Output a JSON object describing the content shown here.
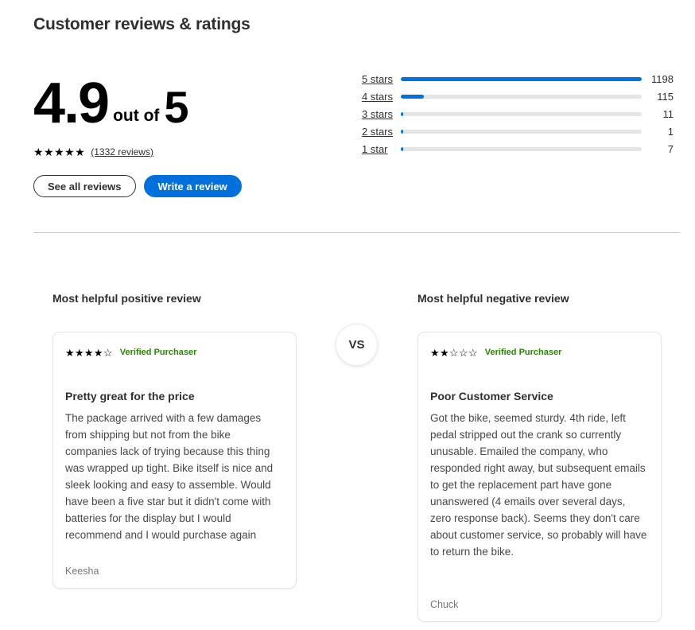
{
  "header": {
    "title": "Customer reviews & ratings"
  },
  "summary": {
    "score": "4.9",
    "out_of_label": "out of",
    "max_score": "5",
    "stars_filled": 5,
    "stars_total": 5,
    "reviews_link": "(1332 reviews)",
    "see_all_label": "See all reviews",
    "write_review_label": "Write a review",
    "primary_color": "#0071dc"
  },
  "histogram": {
    "max": 1198,
    "rows": [
      {
        "label": "5 stars",
        "count": "1198",
        "value": 1198
      },
      {
        "label": "4 stars",
        "count": "115",
        "value": 115
      },
      {
        "label": "3 stars",
        "count": "11",
        "value": 11
      },
      {
        "label": "2 stars",
        "count": "1",
        "value": 1
      },
      {
        "label": "1 star",
        "count": "7",
        "value": 7
      }
    ],
    "fill_color": "#0071dc",
    "track_color": "#e4e5e6"
  },
  "compare": {
    "vs_label": "VS",
    "positive": {
      "heading": "Most helpful positive review",
      "stars_filled": 4,
      "stars_total": 5,
      "verified_label": "Verified Purchaser",
      "verified_color": "#2a8703",
      "title": "Pretty great for the price",
      "body": "The package arrived with a few damages from shipping but not from the bike companies lack of trying because this thing was wrapped up tight. Bike itself is nice and sleek looking and easy to assemble. Would have been a five star but it didn't come with batteries for the display but I would recommend and I would purchase again",
      "author": "Keesha"
    },
    "negative": {
      "heading": "Most helpful negative review",
      "stars_filled": 2,
      "stars_total": 5,
      "verified_label": "Verified Purchaser",
      "verified_color": "#2a8703",
      "title": "Poor Customer Service",
      "body": "Got the bike, seemed sturdy. 4th ride, left pedal stripped out the crank so currently unusable. Emailed the company, who responded right away, but subsequent emails to get the replacement part have gone unanswered (4 emails over several days, zero response back). Seems they don't care about customer service, so probably will have to return the bike.",
      "author": "Chuck"
    }
  }
}
